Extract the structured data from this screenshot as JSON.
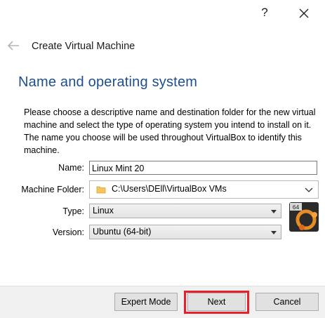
{
  "window": {
    "help_label": "?",
    "close_icon": "close-icon"
  },
  "header": {
    "back_icon": "back-arrow-icon",
    "title": "Create Virtual Machine"
  },
  "section": {
    "title": "Name and operating system",
    "description": "Please choose a descriptive name and destination folder for the new virtual machine and select the type of operating system you intend to install on it. The name you choose will be used throughout VirtualBox to identify this machine."
  },
  "form": {
    "name_label": "Name:",
    "name_value": "Linux Mint 20",
    "folder_label": "Machine Folder:",
    "folder_value": "C:\\Users\\DEll\\VirtualBox VMs",
    "folder_icon": "folder-icon",
    "type_label": "Type:",
    "type_value": "Linux",
    "version_label": "Version:",
    "version_value": "Ubuntu (64-bit)",
    "os_icon_badge": "64",
    "os_icon": "ubuntu-64-icon"
  },
  "buttons": {
    "expert": "Expert Mode",
    "next": "Next",
    "cancel": "Cancel"
  },
  "colors": {
    "section_title": "#1e4e8c",
    "highlight": "#e3222c"
  }
}
